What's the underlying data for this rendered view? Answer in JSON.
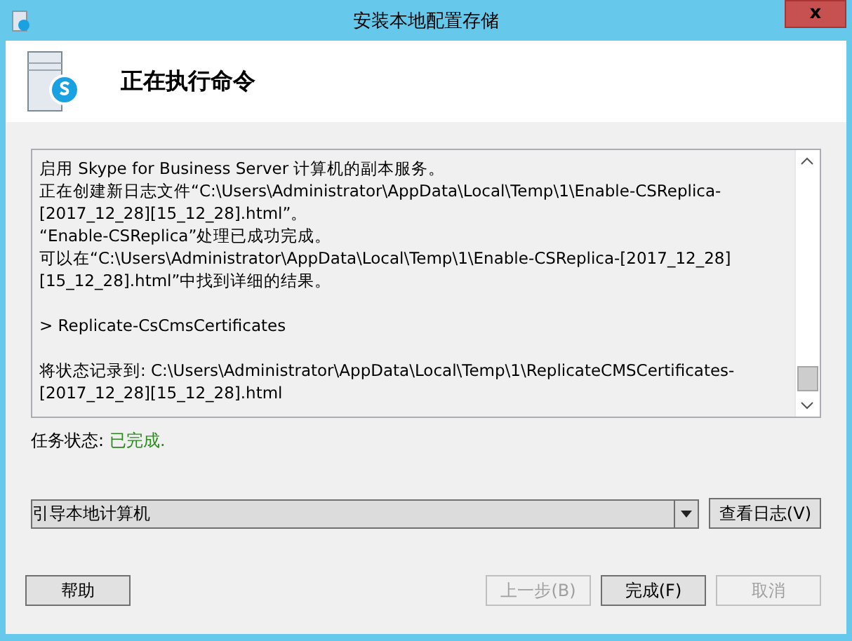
{
  "window": {
    "title": "安装本地配置存储",
    "close": "x"
  },
  "header": {
    "title": "正在执行命令"
  },
  "log": {
    "blocks": [
      {
        "lines": [
          "启用 Skype for Business Server 计算机的副本服务。",
          "正在创建新日志文件“C:\\Users\\Administrator\\AppData\\Local\\Temp\\1\\Enable-CSReplica-",
          "[2017_12_28][15_12_28].html”。",
          "“Enable-CSReplica”处理已成功完成。",
          "可以在“C:\\Users\\Administrator\\AppData\\Local\\Temp\\1\\Enable-CSReplica-[2017_12_28]",
          "[15_12_28].html”中找到详细的结果。"
        ]
      },
      {
        "lines": [
          "> Replicate-CsCmsCertificates"
        ]
      },
      {
        "lines": [
          "将状态记录到: C:\\Users\\Administrator\\AppData\\Local\\Temp\\1\\ReplicateCMSCertificates-",
          "[2017_12_28][15_12_28].html"
        ]
      }
    ]
  },
  "status": {
    "label": "任务状态:",
    "value": "已完成."
  },
  "dropdown": {
    "value": "引导本地计算机"
  },
  "view_log_button": {
    "label": "查看日志(V)",
    "disabled": false
  },
  "buttons": [
    {
      "label": "帮助",
      "disabled": false
    },
    {
      "label": "上一步(B)",
      "disabled": true
    },
    {
      "label": "完成(F)",
      "disabled": false
    },
    {
      "label": "取消",
      "disabled": true
    }
  ]
}
